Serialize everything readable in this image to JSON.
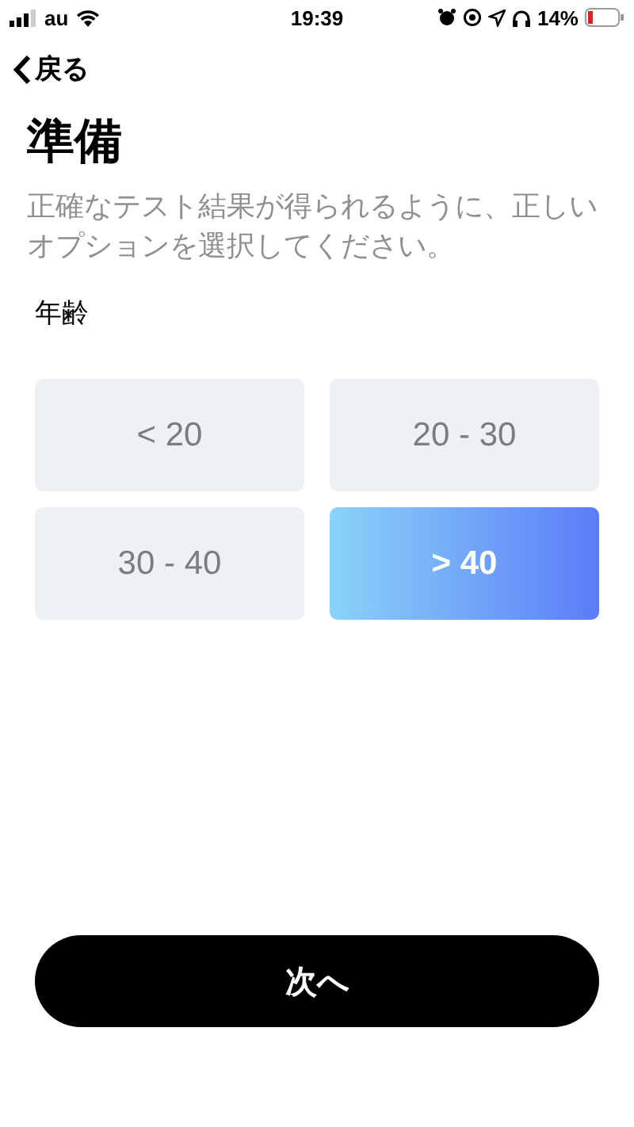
{
  "status_bar": {
    "carrier": "au",
    "time": "19:39",
    "battery": "14%"
  },
  "nav": {
    "back": "戻る"
  },
  "title": "準備",
  "description": "正確なテスト結果が得られるように、正しいオプションを選択してください。",
  "age_label": "年齢",
  "options": [
    {
      "label": "< 20",
      "selected": false
    },
    {
      "label": "20 - 30",
      "selected": false
    },
    {
      "label": "30 - 40",
      "selected": false
    },
    {
      "label": "> 40",
      "selected": true
    }
  ],
  "next_button": "次へ"
}
